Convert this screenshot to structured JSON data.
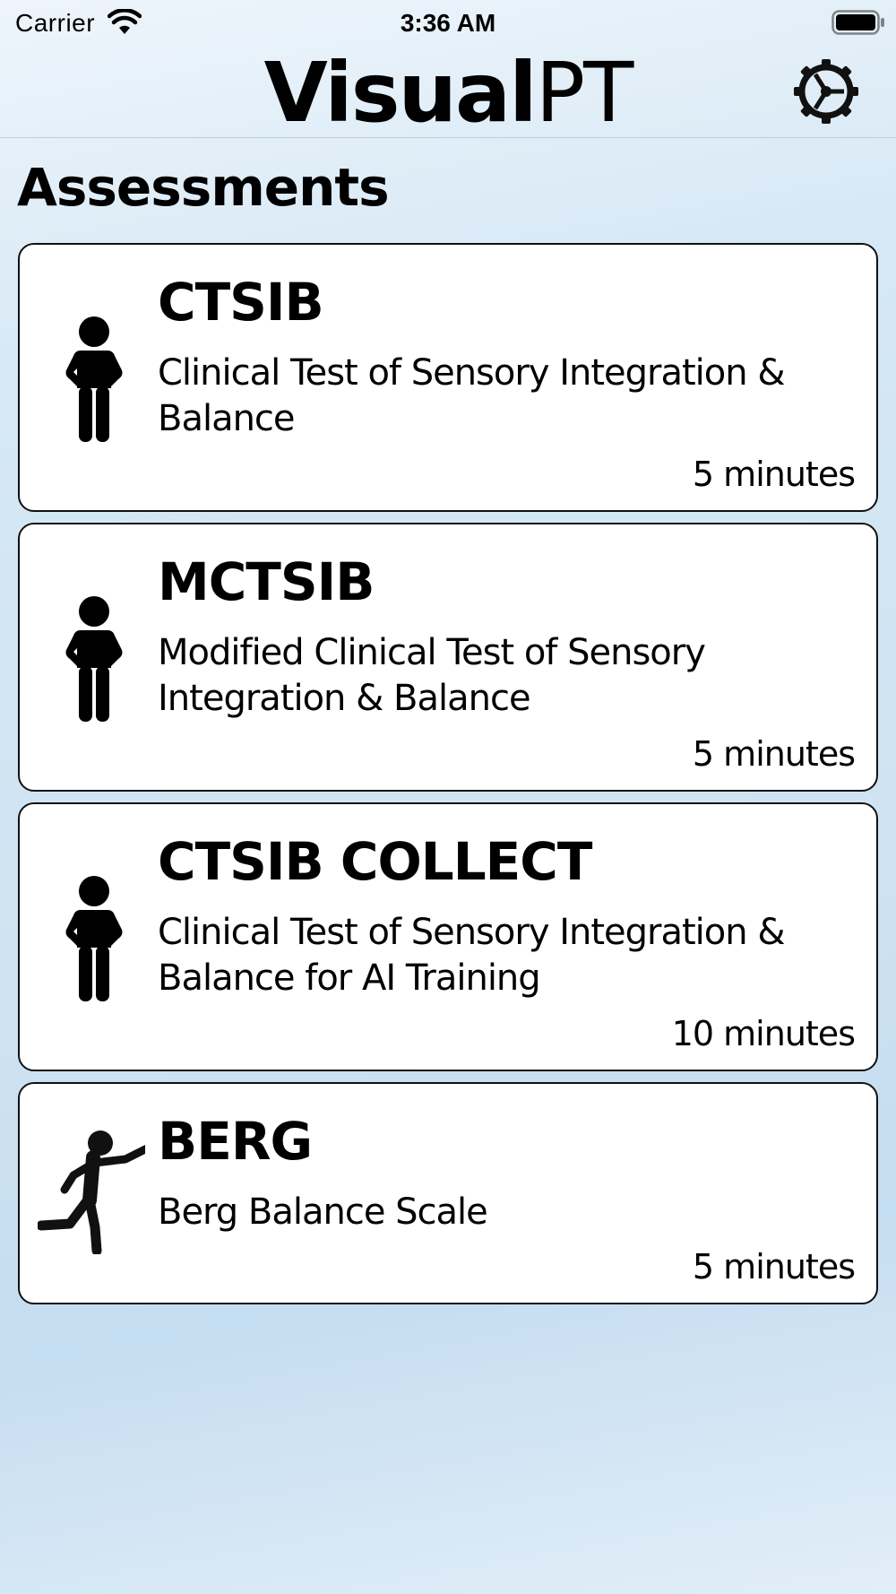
{
  "status_bar": {
    "carrier": "Carrier",
    "time": "3:36 AM",
    "wifi_icon": "wifi-icon",
    "battery_icon": "battery-full-icon"
  },
  "nav": {
    "title_bold": "Visual",
    "title_light": "PT",
    "settings_icon": "gear-icon"
  },
  "section": {
    "title": "Assessments"
  },
  "assessments": [
    {
      "code": "CTSIB",
      "description": "Clinical Test of Sensory Integration & Balance",
      "duration": "5 minutes",
      "icon": "standing-person-icon"
    },
    {
      "code": "MCTSIB",
      "description": "Modified Clinical Test of Sensory Integration & Balance",
      "duration": "5 minutes",
      "icon": "standing-person-icon"
    },
    {
      "code": "CTSIB COLLECT",
      "description": "Clinical Test of Sensory Integration & Balance for AI Training",
      "duration": "10 minutes",
      "icon": "standing-person-icon"
    },
    {
      "code": "BERG",
      "description": "Berg Balance Scale",
      "duration": "5 minutes",
      "icon": "reaching-person-icon"
    }
  ]
}
